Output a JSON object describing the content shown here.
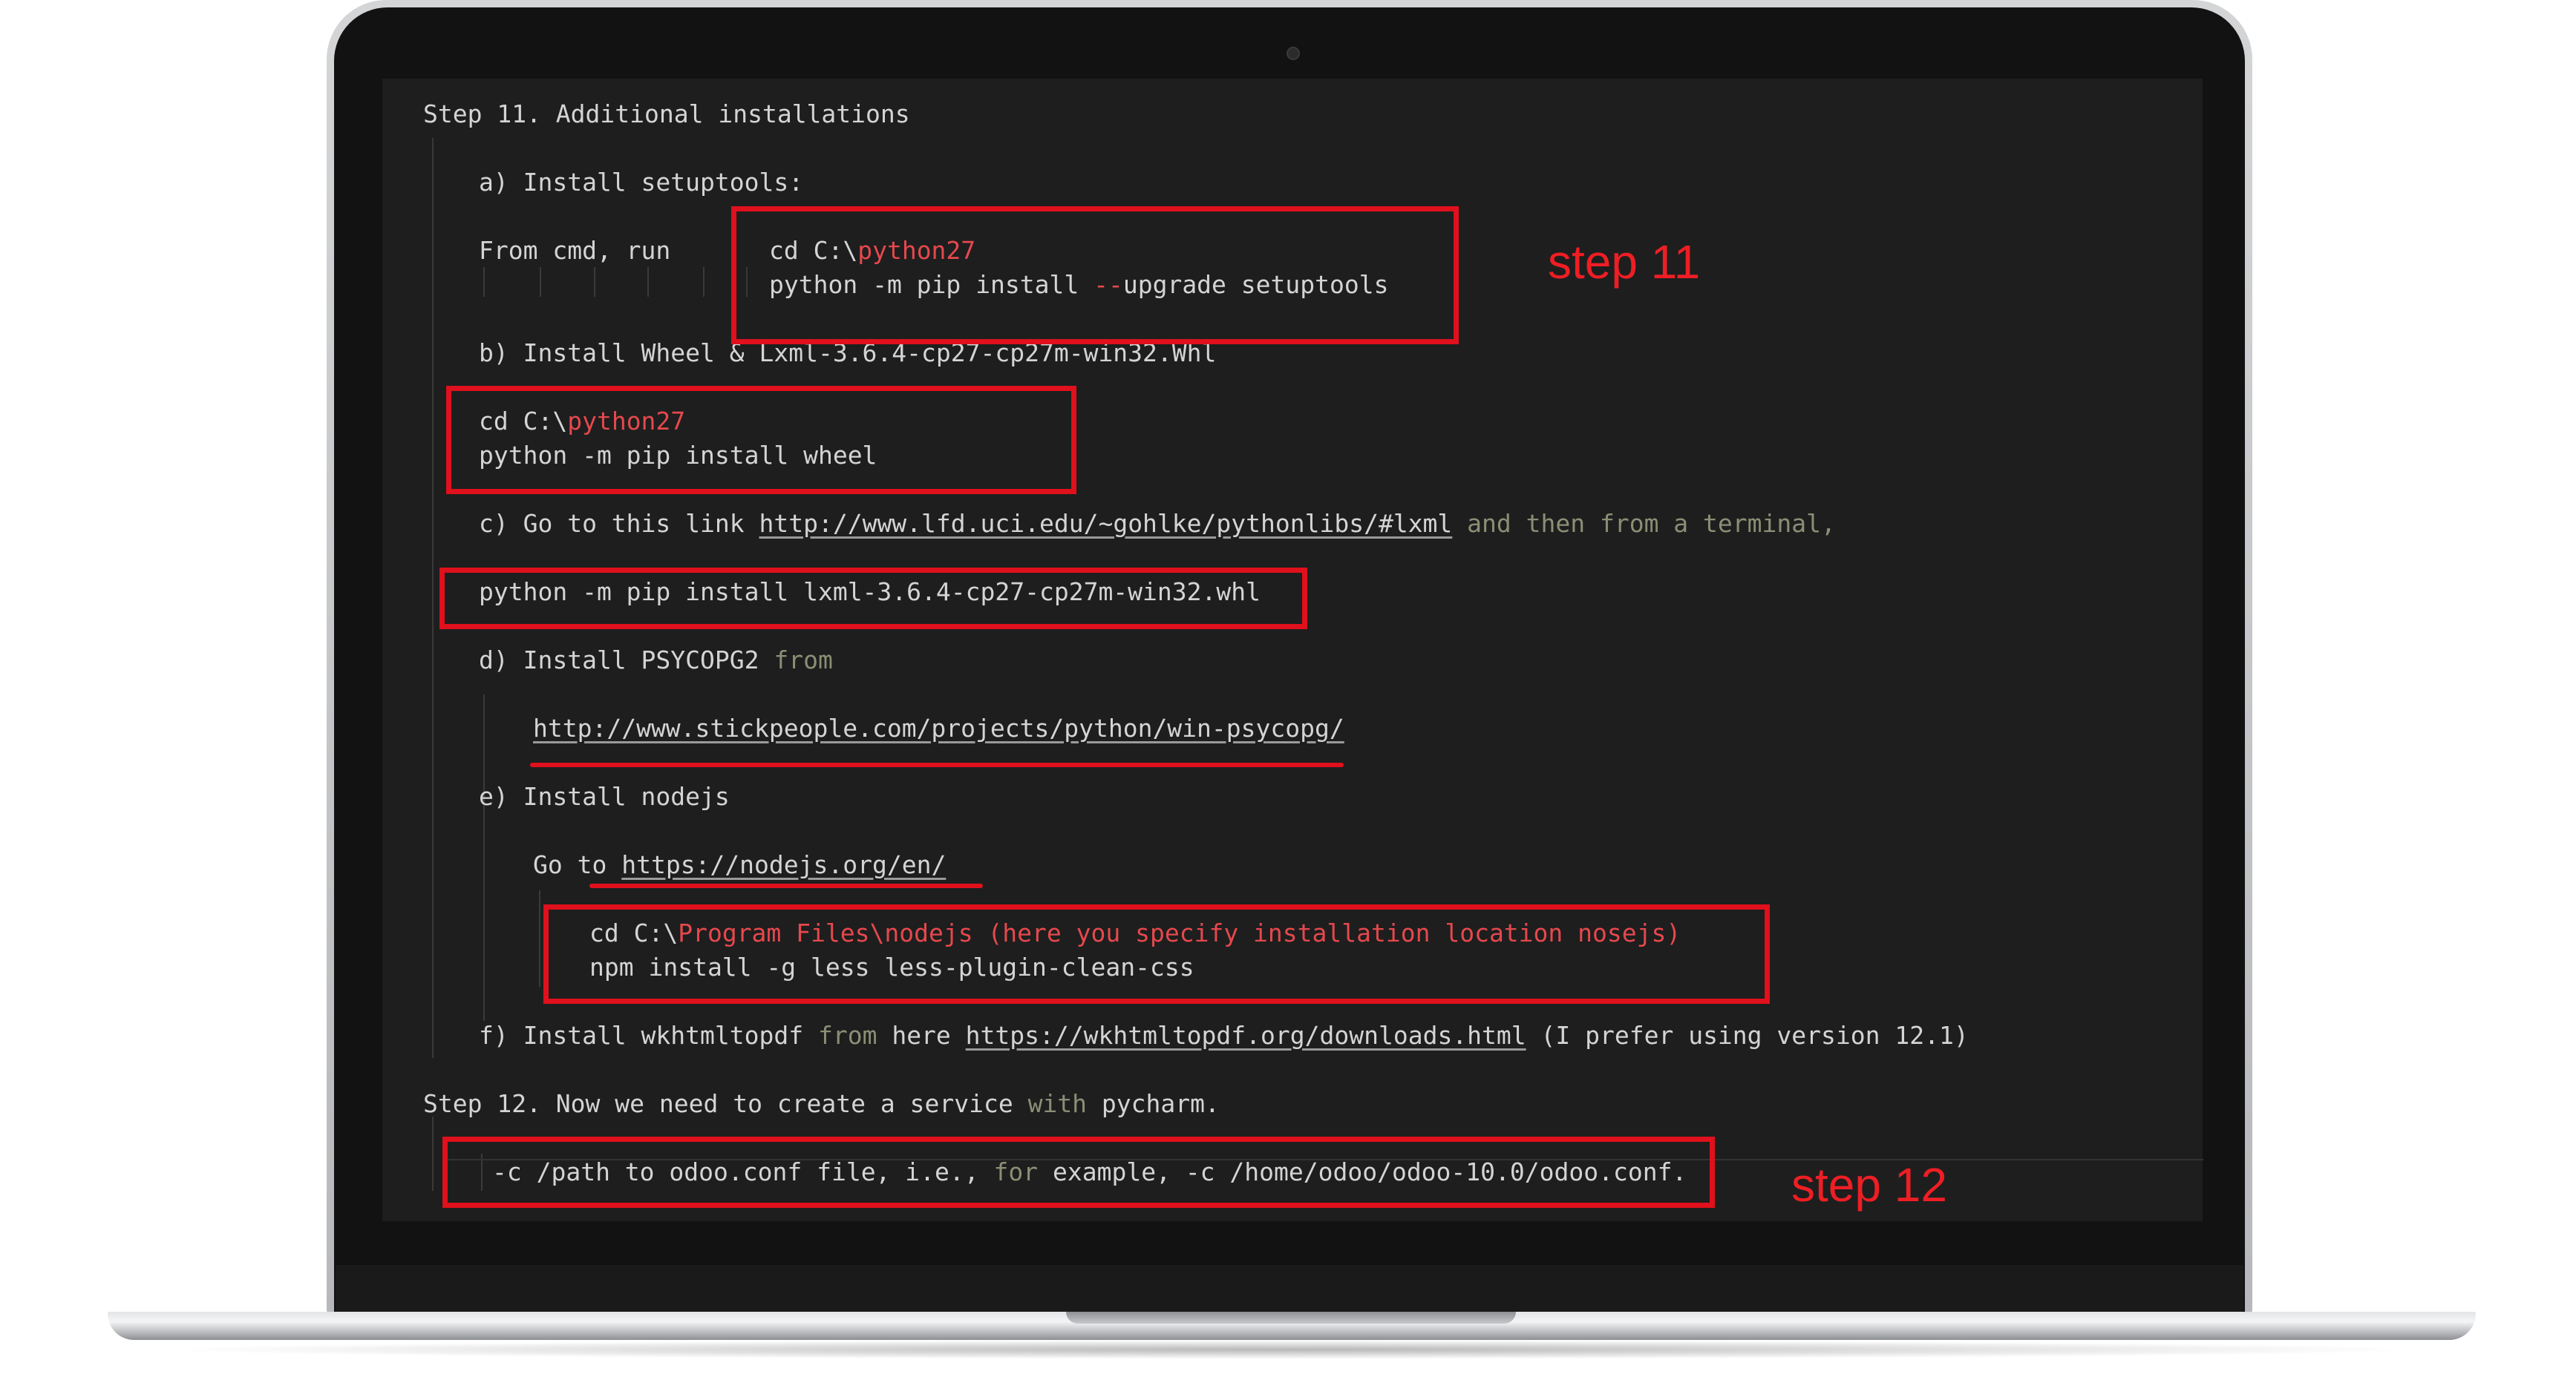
{
  "colors": {
    "accent_red": "#e0101c",
    "terminal_bg": "#1e1e1e",
    "text": "#d4d4d4",
    "path_red": "#e5484d",
    "dim": "#8a8f75"
  },
  "lines": {
    "l1": "Step 11. Additional installations",
    "l2": "a) Install setuptools:",
    "l3_label": "From cmd, run",
    "l3_cmd_prefix": "cd C:\\",
    "l3_cmd_red": "python27",
    "l4_a": "python -m pip install ",
    "l4_dash": "--",
    "l4_b": "upgrade setuptools",
    "l5": "b) Install Wheel & Lxml-3.6.4-cp27-cp27m-win32.Whl",
    "l6_prefix": "cd C:\\",
    "l6_red": "python27",
    "l7": "python -m pip install wheel",
    "l8_a": "c) Go to this link ",
    "l8_link": "http://www.lfd.uci.edu/~gohlke/pythonlibs/",
    "l8_hash": "#lxml",
    "l8_rest": " and then from a terminal,",
    "l9": "python -m pip install lxml-3.6.4-cp27-cp27m-win32.whl",
    "l10_a": "d) Install PSYCOPG2 ",
    "l10_from": "from",
    "l11_link": "http://www.stickpeople.com/projects/python/win-psycopg/",
    "l12": "e) Install nodejs",
    "l13_a": "Go to ",
    "l13_link": "https://nodejs.org/en/",
    "l14_prefix": "cd C:\\",
    "l14_red": "Program Files\\nodejs (here you specify installation location nosejs)",
    "l15": "npm install -g less less-plugin-clean-css",
    "l16_a": "f) Install wkhtmltopdf ",
    "l16_from": "from",
    "l16_b": " here ",
    "l16_link": "https://wkhtmltopdf.org/downloads.html",
    "l16_rest": " (I prefer using version 12.1)",
    "l17_a": "Step 12. Now we need to create a service ",
    "l17_with": "with",
    "l17_b": " pycharm.",
    "l18_a": "-c /path to odoo.conf file, i.e., ",
    "l18_for": "for",
    "l18_b": " example, -c /home/odoo/odoo-10.0/odoo.conf."
  },
  "annotations": {
    "step11": "step 11",
    "step12": "step 12"
  }
}
